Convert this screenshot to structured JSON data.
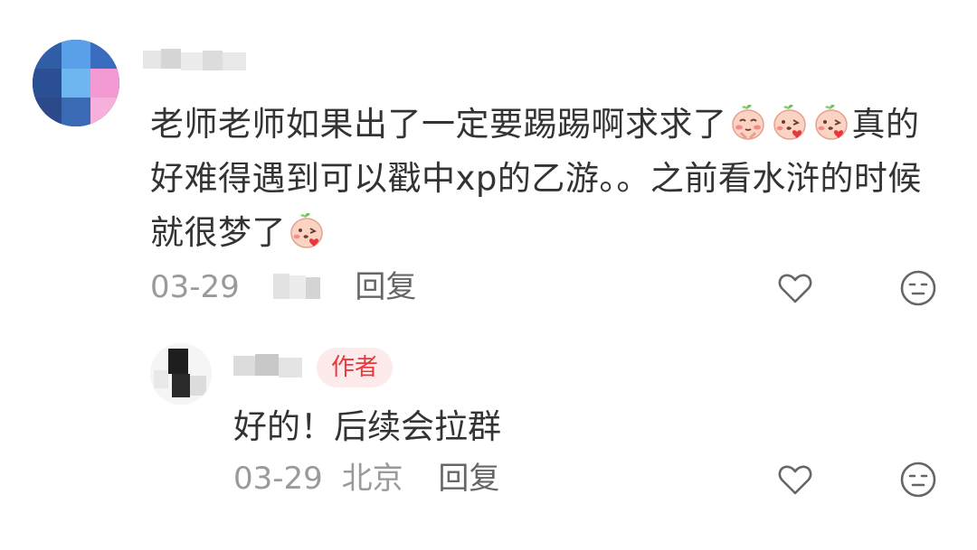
{
  "comment": {
    "text_part1": "老师老师如果出了一定要踢踢啊求求了",
    "text_part2": "真的好难得遇到可以戳中xp的乙游。。之前看水浒的时候就很梦了",
    "date": "03-29",
    "reply_label": "回复",
    "emojis": [
      "blushing-radish-emoji",
      "kissing-radish-emoji",
      "kissing-radish-emoji",
      "kissing-radish-emoji"
    ]
  },
  "reply": {
    "badge": "作者",
    "text": "好的！后续会拉群",
    "date": "03-29",
    "location": "北京",
    "reply_label": "回复"
  },
  "icons": {
    "like": "heart-icon",
    "dislike": "neutral-face-icon"
  },
  "colors": {
    "text": "#333333",
    "meta": "#9a9a9a",
    "badge_text": "#e8383d",
    "badge_bg": "#fdeaea"
  }
}
